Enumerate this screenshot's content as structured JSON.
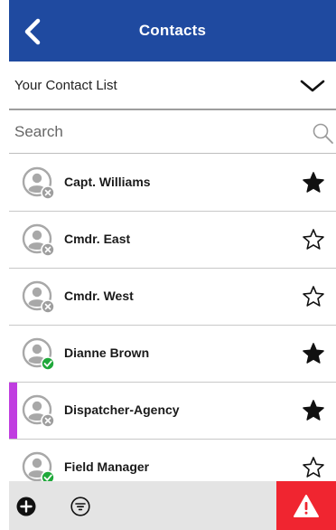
{
  "header": {
    "title": "Contacts",
    "back_icon": "chevron-left-icon",
    "background": "#1f4aa0"
  },
  "list_selector": {
    "label": "Your Contact List",
    "icon": "chevron-down-icon"
  },
  "search": {
    "placeholder": "Search",
    "value": "",
    "icon": "search-icon"
  },
  "contacts": [
    {
      "name": "Capt. Williams",
      "status": "offline",
      "favorite": true,
      "selected": false
    },
    {
      "name": "Cmdr. East",
      "status": "offline",
      "favorite": false,
      "selected": false
    },
    {
      "name": "Cmdr. West",
      "status": "offline",
      "favorite": false,
      "selected": false
    },
    {
      "name": "Dianne Brown",
      "status": "online",
      "favorite": true,
      "selected": false
    },
    {
      "name": "Dispatcher-Agency",
      "status": "offline",
      "favorite": true,
      "selected": true
    },
    {
      "name": "Field Manager",
      "status": "online",
      "favorite": false,
      "selected": false
    }
  ],
  "bottom_bar": {
    "add_icon": "plus-circle-icon",
    "filter_icon": "filter-icon",
    "emergency_icon": "warning-triangle-icon",
    "emergency_color": "#f02530"
  },
  "colors": {
    "online": "#1fa83a",
    "offline": "#9e9e9e",
    "selected_marker": "#c03ee0"
  }
}
